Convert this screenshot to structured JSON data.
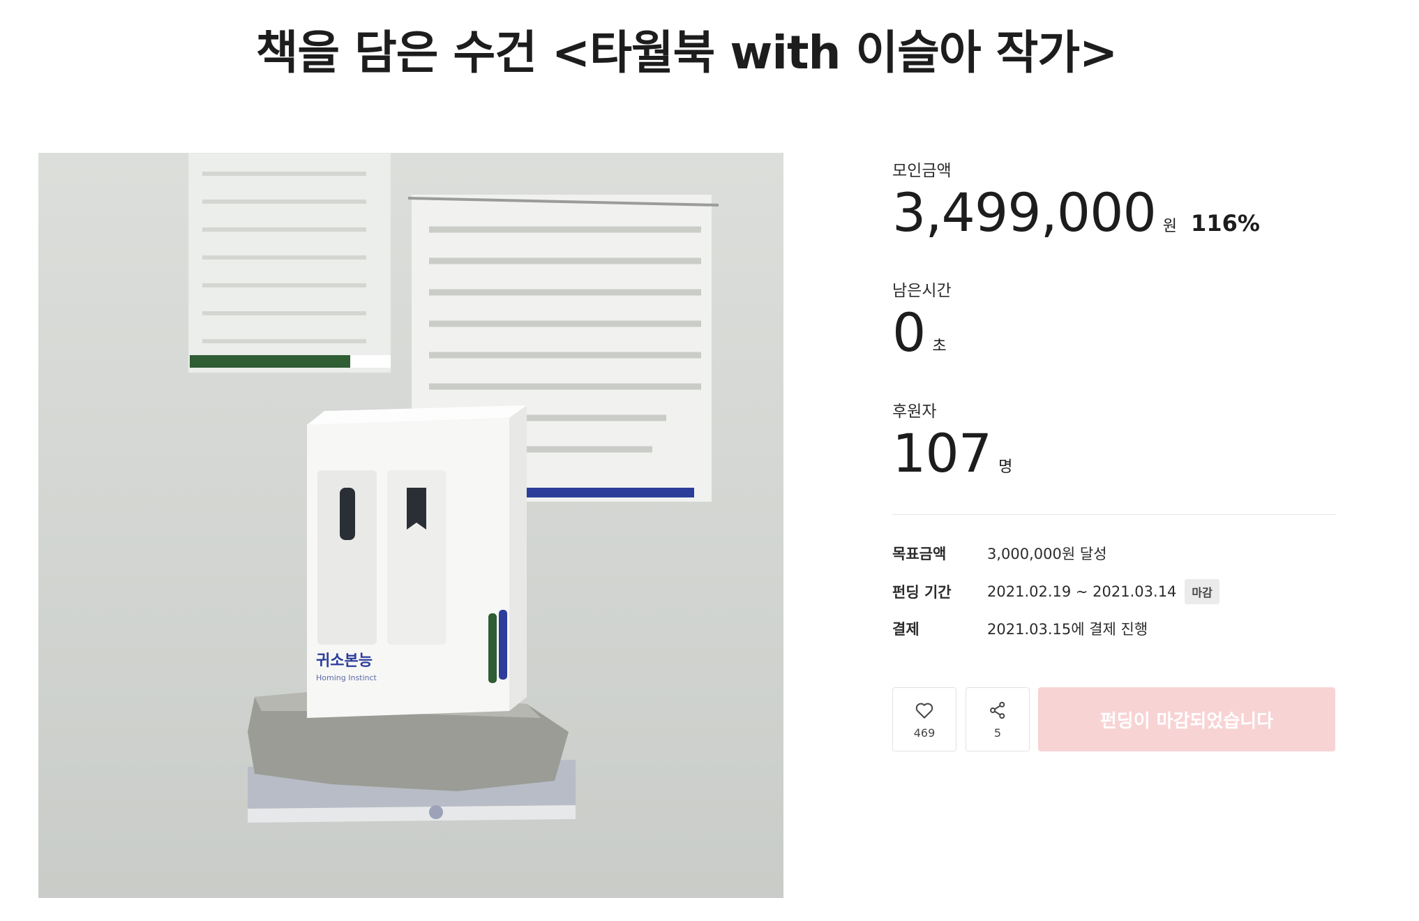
{
  "page": {
    "title": "책을 담은 수건 <타월북 with 이슬아 작가>"
  },
  "stats": {
    "raised": {
      "label": "모인금액",
      "value": "3,499,000",
      "unit": "원",
      "percent": "116%"
    },
    "time_left": {
      "label": "남은시간",
      "value": "0",
      "unit": "초"
    },
    "backers": {
      "label": "후원자",
      "value": "107",
      "unit": "명"
    }
  },
  "info": {
    "goal": {
      "key": "목표금액",
      "value": "3,000,000원 달성"
    },
    "period": {
      "key": "펀딩 기간",
      "value": "2021.02.19 ~ 2021.03.14",
      "badge": "마감"
    },
    "payment": {
      "key": "결제",
      "value": "2021.03.15에 결제 진행"
    }
  },
  "actions": {
    "like": {
      "icon": "heart-icon",
      "count": "469"
    },
    "share": {
      "icon": "share-icon",
      "count": "5"
    },
    "cta_label": "펀딩이 마감되었습니다"
  },
  "image": {
    "box_title": "귀소본능",
    "box_subtitle": "Homing Instinct"
  },
  "colors": {
    "cta_disabled": "#f8d3d4",
    "text": "#1d1d1d",
    "brand_green": "#2f5d34",
    "brand_blue": "#2c3d9a"
  }
}
